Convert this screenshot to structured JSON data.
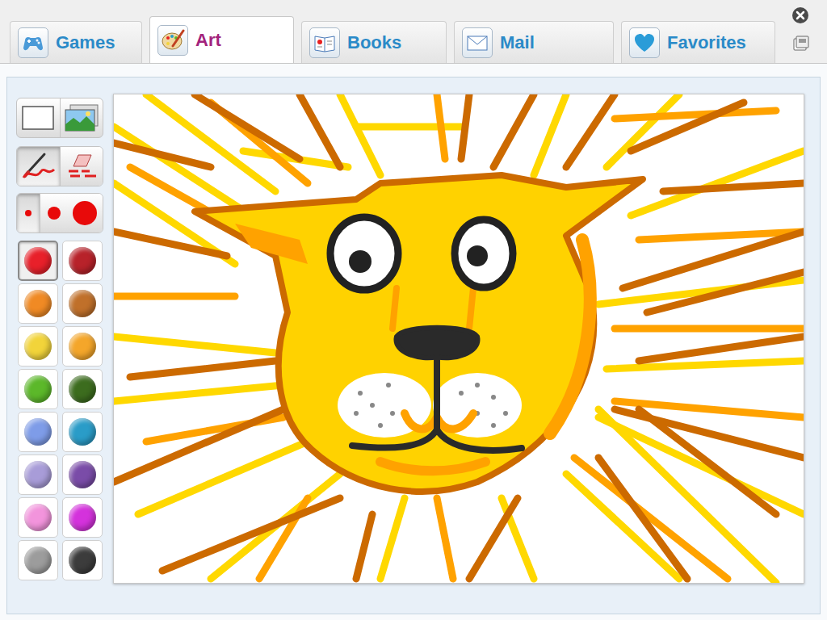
{
  "tabs": [
    {
      "label": "Games",
      "selected": false
    },
    {
      "label": "Art",
      "selected": true
    },
    {
      "label": "Books",
      "selected": false
    },
    {
      "label": "Mail",
      "selected": false
    },
    {
      "label": "Favorites",
      "selected": false
    }
  ],
  "drawing_tools": [
    {
      "kind": "brush",
      "selected": true
    },
    {
      "kind": "eraser",
      "selected": false
    }
  ],
  "brush_sizes": [
    {
      "kind": "small",
      "selected": true
    },
    {
      "kind": "medium",
      "selected": false
    },
    {
      "kind": "large",
      "selected": false
    }
  ],
  "palette": [
    {
      "color": "#e8202a",
      "selected": true
    },
    {
      "color": "#b8222a",
      "selected": false
    },
    {
      "color": "#f08a24",
      "selected": false
    },
    {
      "color": "#c0702a",
      "selected": false
    },
    {
      "color": "#f2d43a",
      "selected": false
    },
    {
      "color": "#f4a62a",
      "selected": false
    },
    {
      "color": "#5cb82a",
      "selected": false
    },
    {
      "color": "#3c6c1e",
      "selected": false
    },
    {
      "color": "#7e9ce8",
      "selected": false
    },
    {
      "color": "#2a9cc8",
      "selected": false
    },
    {
      "color": "#a89cd8",
      "selected": false
    },
    {
      "color": "#7a4ca8",
      "selected": false
    },
    {
      "color": "#f294dc",
      "selected": false
    },
    {
      "color": "#d432dc",
      "selected": false
    },
    {
      "color": "#9c9c9c",
      "selected": false
    },
    {
      "color": "#3c3c3c",
      "selected": false
    }
  ]
}
